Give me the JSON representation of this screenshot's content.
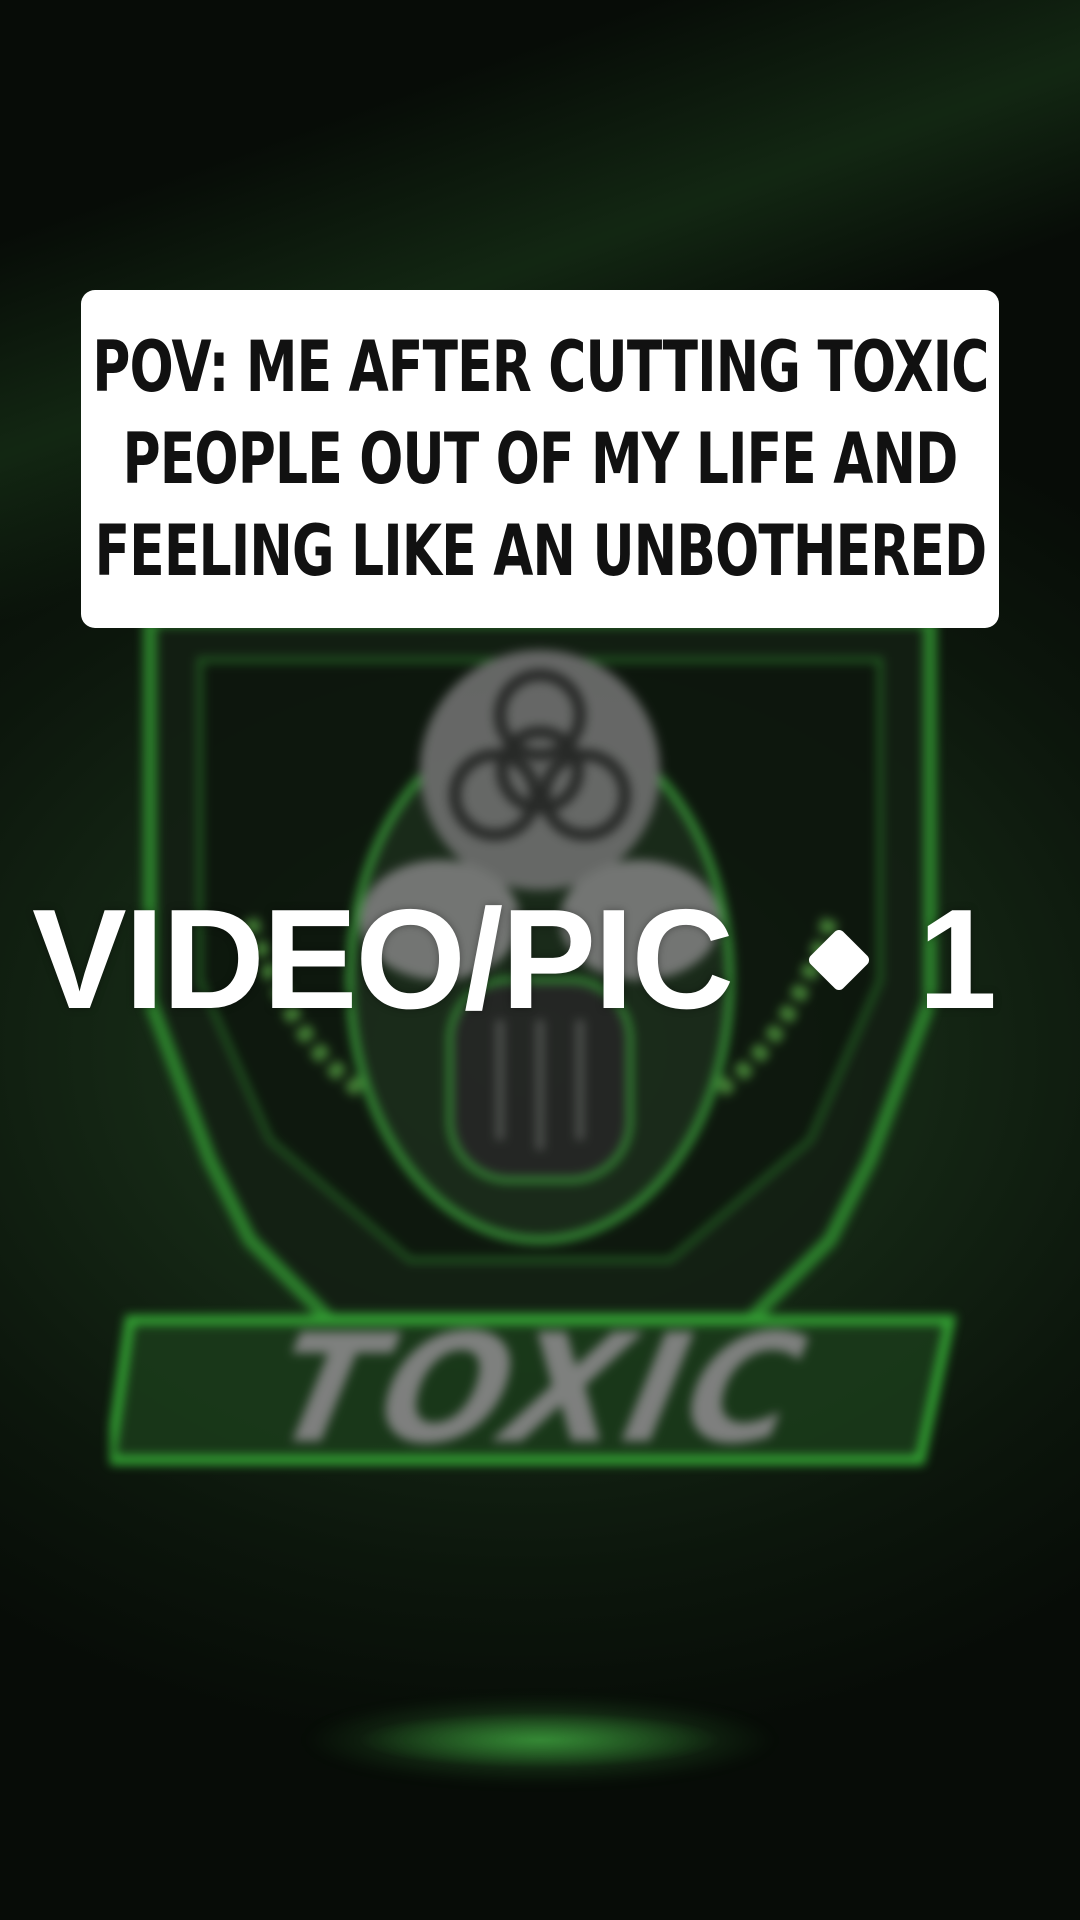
{
  "caption": {
    "lines": [
      "POV: ME AFTER CUTTING TOXIC",
      "PEOPLE OUT OF MY LIFE AND",
      "FEELING LIKE AN UNBOTHERED"
    ]
  },
  "overlay": {
    "label": "VIDEO/PIC",
    "separator_icon": "diamond-icon",
    "number": "1"
  },
  "background": {
    "logo_text": "TOXIC",
    "logo_icon": "biohazard-icon",
    "colors": {
      "accent_green": "#3fbf3f",
      "dark_green": "#0c160c",
      "logo_grey": "#8a8a8a"
    }
  }
}
